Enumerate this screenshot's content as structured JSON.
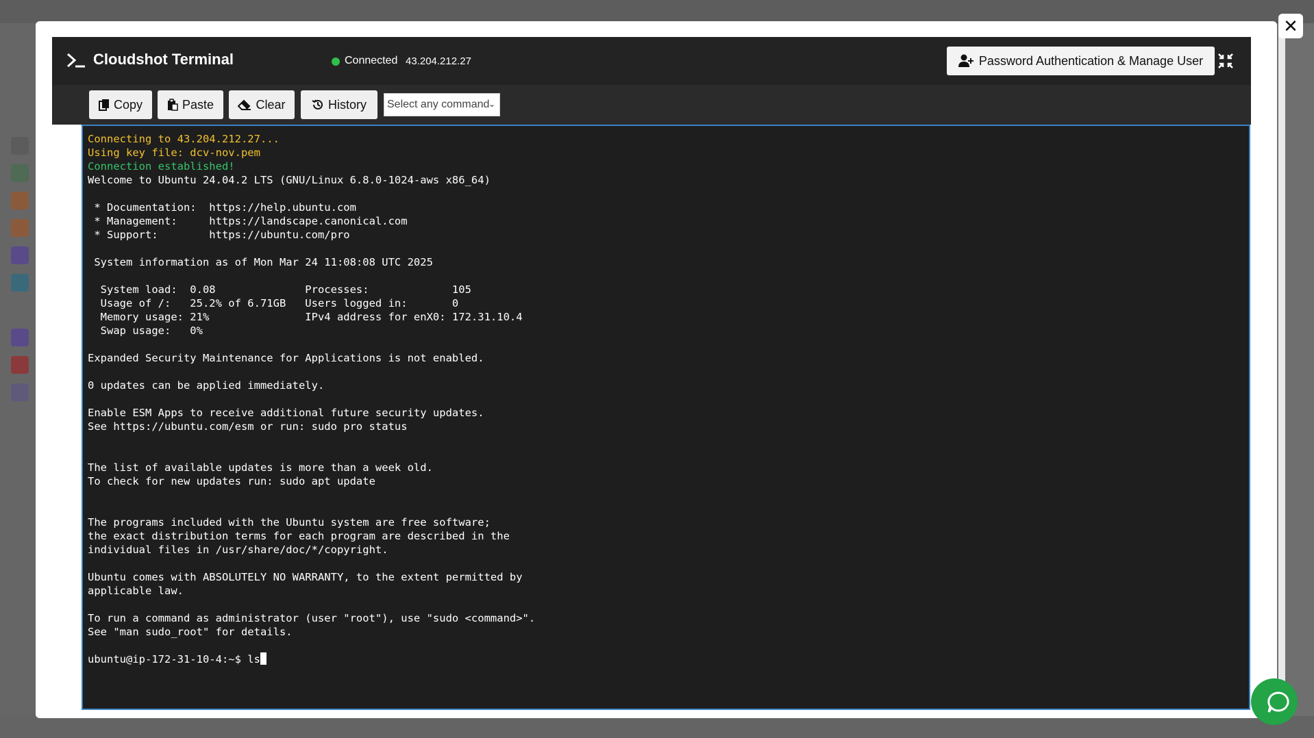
{
  "header": {
    "title": "Cloudshot Terminal",
    "status": "Connected",
    "ip": "43.204.212.27",
    "auth_button": "Password Authentication & Manage User"
  },
  "toolbar": {
    "copy": "Copy",
    "paste": "Paste",
    "clear": "Clear",
    "history": "History",
    "command_select": "Select any command"
  },
  "terminal": {
    "lines": [
      {
        "text": "Connecting to 43.204.212.27...",
        "color": "yellow"
      },
      {
        "text": "Using key file: dcv-nov.pem",
        "color": "yellow"
      },
      {
        "text": "Connection established!",
        "color": "green"
      },
      {
        "text": "Welcome to Ubuntu 24.04.2 LTS (GNU/Linux 6.8.0-1024-aws x86_64)",
        "color": "white"
      },
      {
        "text": "",
        "color": "white"
      },
      {
        "text": " * Documentation:  https://help.ubuntu.com",
        "color": "white"
      },
      {
        "text": " * Management:     https://landscape.canonical.com",
        "color": "white"
      },
      {
        "text": " * Support:        https://ubuntu.com/pro",
        "color": "white"
      },
      {
        "text": "",
        "color": "white"
      },
      {
        "text": " System information as of Mon Mar 24 11:08:08 UTC 2025",
        "color": "white"
      },
      {
        "text": "",
        "color": "white"
      },
      {
        "text": "  System load:  0.08              Processes:             105",
        "color": "white"
      },
      {
        "text": "  Usage of /:   25.2% of 6.71GB   Users logged in:       0",
        "color": "white"
      },
      {
        "text": "  Memory usage: 21%               IPv4 address for enX0: 172.31.10.4",
        "color": "white"
      },
      {
        "text": "  Swap usage:   0%",
        "color": "white"
      },
      {
        "text": "",
        "color": "white"
      },
      {
        "text": "Expanded Security Maintenance for Applications is not enabled.",
        "color": "white"
      },
      {
        "text": "",
        "color": "white"
      },
      {
        "text": "0 updates can be applied immediately.",
        "color": "white"
      },
      {
        "text": "",
        "color": "white"
      },
      {
        "text": "Enable ESM Apps to receive additional future security updates.",
        "color": "white"
      },
      {
        "text": "See https://ubuntu.com/esm or run: sudo pro status",
        "color": "white"
      },
      {
        "text": "",
        "color": "white"
      },
      {
        "text": "",
        "color": "white"
      },
      {
        "text": "The list of available updates is more than a week old.",
        "color": "white"
      },
      {
        "text": "To check for new updates run: sudo apt update",
        "color": "white"
      },
      {
        "text": "",
        "color": "white"
      },
      {
        "text": "",
        "color": "white"
      },
      {
        "text": "The programs included with the Ubuntu system are free software;",
        "color": "white"
      },
      {
        "text": "the exact distribution terms for each program are described in the",
        "color": "white"
      },
      {
        "text": "individual files in /usr/share/doc/*/copyright.",
        "color": "white"
      },
      {
        "text": "",
        "color": "white"
      },
      {
        "text": "Ubuntu comes with ABSOLUTELY NO WARRANTY, to the extent permitted by",
        "color": "white"
      },
      {
        "text": "applicable law.",
        "color": "white"
      },
      {
        "text": "",
        "color": "white"
      },
      {
        "text": "To run a command as administrator (user \"root\"), use \"sudo <command>\".",
        "color": "white"
      },
      {
        "text": "See \"man sudo_root\" for details.",
        "color": "white"
      },
      {
        "text": "",
        "color": "white"
      }
    ],
    "prompt": "ubuntu@ip-172-31-10-4:~$ ",
    "input": "ls"
  },
  "colors": {
    "accent_border": "#3b82c4",
    "status_green": "#2fbf4a",
    "yellow_text": "#f2c12e",
    "green_text": "#36c46a",
    "chat_button": "#22a447"
  },
  "icons": [
    "terminal-icon",
    "user-plus-icon",
    "compress-icon",
    "close-icon",
    "copy-icon",
    "paste-icon",
    "eraser-icon",
    "history-icon",
    "chevron-down-icon",
    "chat-icon"
  ]
}
